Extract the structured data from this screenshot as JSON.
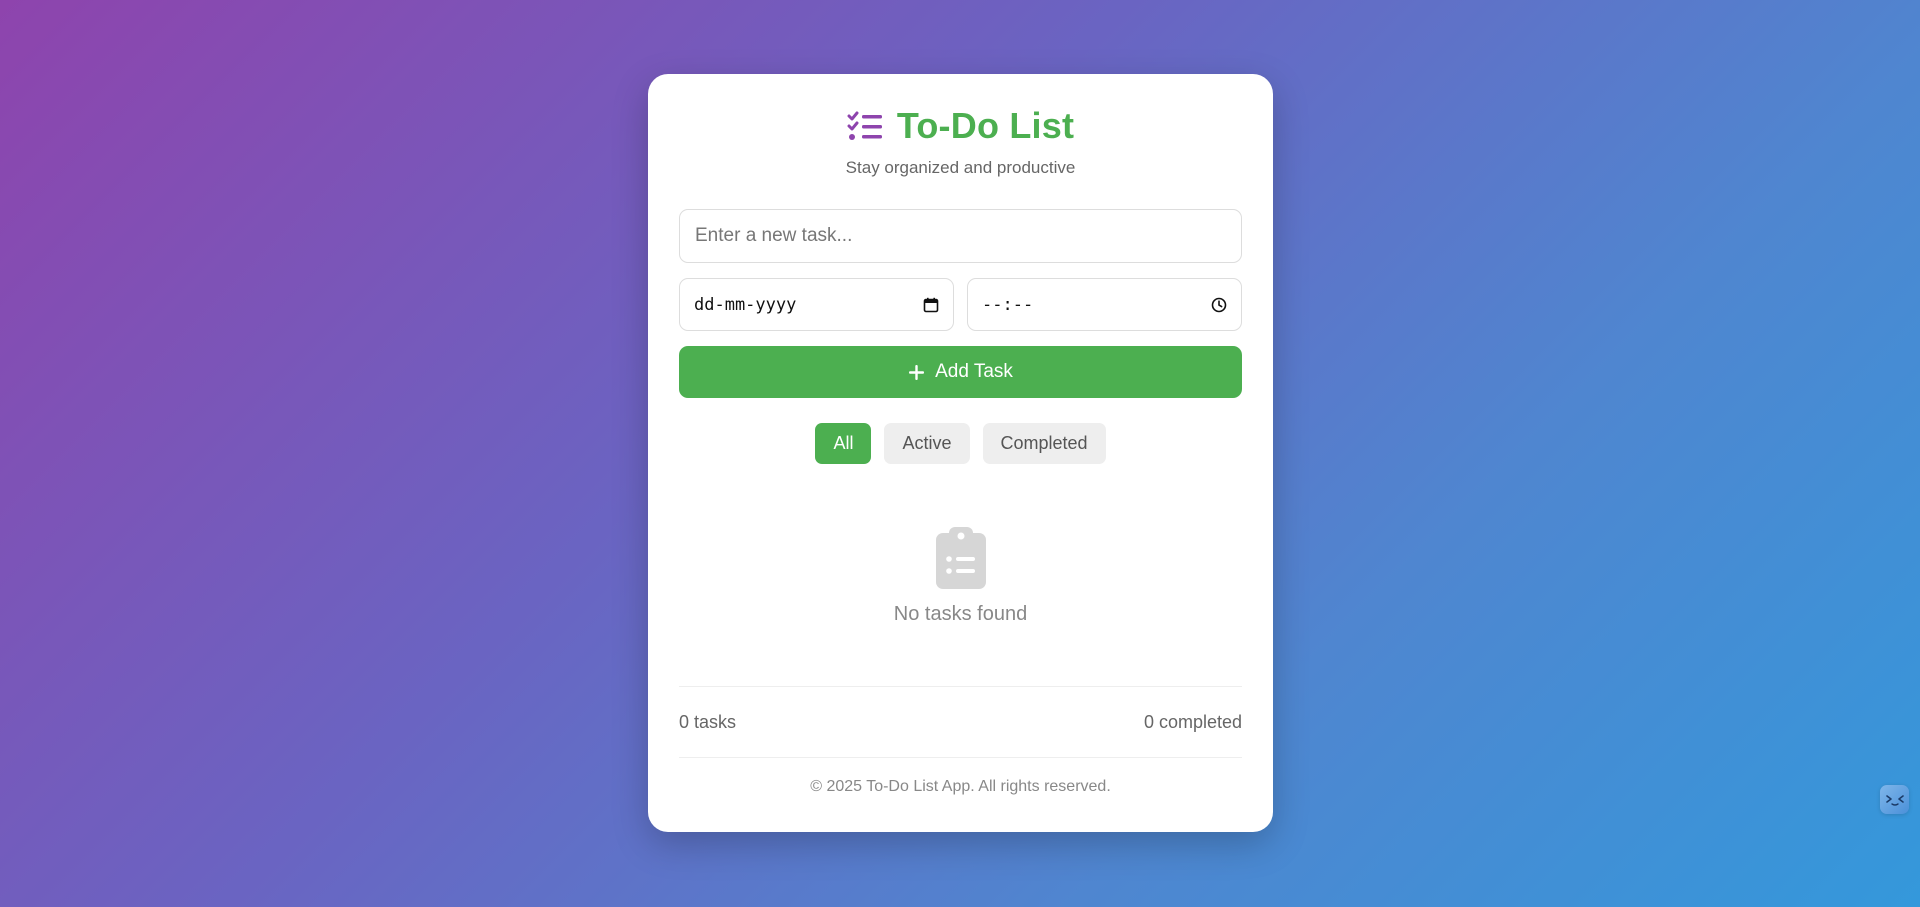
{
  "app": {
    "title": "To-Do List",
    "subtitle": "Stay organized and productive",
    "title_icon": "tasks-checklist-icon",
    "accent_color": "#4caf50",
    "icon_color": "#8e44ad"
  },
  "form": {
    "task_placeholder": "Enter a new task...",
    "task_value": "",
    "date_placeholder": "dd-mm-yyyy",
    "time_placeholder": "--:--",
    "add_label": "Add Task"
  },
  "filters": [
    {
      "label": "All",
      "active": true
    },
    {
      "label": "Active",
      "active": false
    },
    {
      "label": "Completed",
      "active": false
    }
  ],
  "empty_state": {
    "icon": "clipboard-list-icon",
    "text": "No tasks found"
  },
  "stats": {
    "total": "0 tasks",
    "completed": "0 completed"
  },
  "footer": {
    "text": "© 2025 To-Do List App. All rights reserved."
  }
}
